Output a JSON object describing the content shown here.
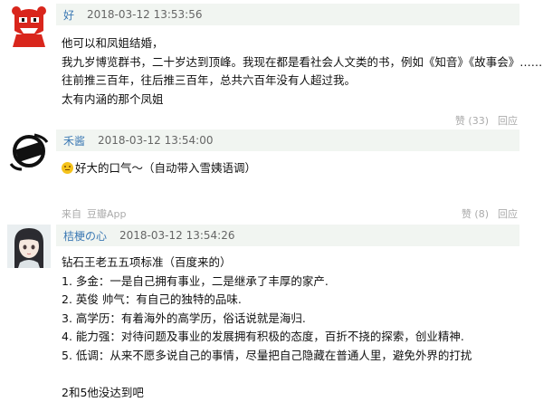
{
  "comments": [
    {
      "author": "好",
      "time": "2018-03-12 13:53:56",
      "lines": [
        "他可以和凤姐结婚，",
        "我九岁博览群书，二十岁达到顶峰。我现在都是看社会人文类的书，例如《知音》《故事会》……",
        "往前推三百年，往后推三百年，总共六百年没有人超过我。",
        "太有内涵的那个凤姐"
      ],
      "like_label": "赞 (33)",
      "reply_label": "回应"
    },
    {
      "author": "禾酱",
      "time": "2018-03-12 13:54:00",
      "text": "好大的口气～（自动带入雪姨语调）",
      "emoji_icon": "sweat-smile-emoji",
      "source_prefix": "来自",
      "source_app": "豆瓣App",
      "like_label": "赞 (8)",
      "reply_label": "回应"
    },
    {
      "author": "桔梗の心",
      "time": "2018-03-12 13:54:26",
      "lines": [
        "钻石王老五五项标准（百度来的）",
        "1. 多金：一是自己拥有事业，二是继承了丰厚的家产.",
        "2. 英俊 帅气：有自己的独特的品味.",
        "3. 高学历：有着海外的高学历，俗话说就是海归.",
        "4. 能力强：对待问题及事业的发展拥有积极的态度，百折不挠的探索，创业精神.",
        "5. 低调：从来不愿多说自己的事情，尽量把自己隐藏在普通人里，避免外界的打扰",
        "",
        "2和5他没达到吧"
      ]
    }
  ],
  "colors": {
    "author": "#3c79b4",
    "header_bg": "#f1f5f1",
    "meta": "#aaaaaa"
  }
}
